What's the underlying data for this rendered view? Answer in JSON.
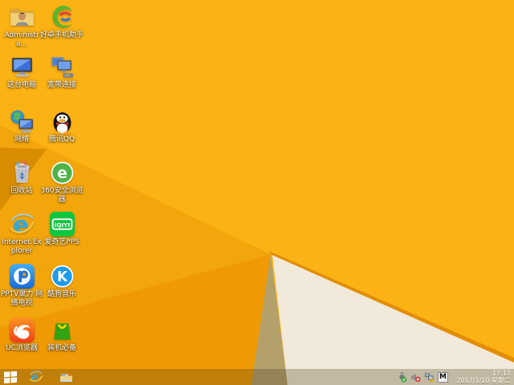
{
  "desktop": {
    "icons": [
      {
        "id": "admin-folder",
        "label": "Administra...",
        "position": {
          "col": 1,
          "row": 1
        }
      },
      {
        "id": "haozhuo-assistant",
        "label": "好卓手机助手",
        "position": {
          "col": 2,
          "row": 1
        }
      },
      {
        "id": "this-pc",
        "label": "这台电脑",
        "position": {
          "col": 1,
          "row": 2
        }
      },
      {
        "id": "broadband",
        "label": "宽带连接",
        "position": {
          "col": 2,
          "row": 2
        }
      },
      {
        "id": "network",
        "label": "网络",
        "position": {
          "col": 1,
          "row": 3
        }
      },
      {
        "id": "tencent-qq",
        "label": "腾讯QQ",
        "position": {
          "col": 2,
          "row": 3
        }
      },
      {
        "id": "recycle-bin",
        "label": "回收站",
        "position": {
          "col": 1,
          "row": 4
        }
      },
      {
        "id": "360-browser",
        "label": "360安全浏览器",
        "position": {
          "col": 2,
          "row": 4
        }
      },
      {
        "id": "internet-explorer",
        "label": "Internet Explorer",
        "position": {
          "col": 1,
          "row": 5
        }
      },
      {
        "id": "iqiyi-pps",
        "label": "爱奇艺PPS",
        "position": {
          "col": 2,
          "row": 5
        }
      },
      {
        "id": "pptv",
        "label": "PPTV聚力 网络电视",
        "position": {
          "col": 1,
          "row": 6
        }
      },
      {
        "id": "kugou-music",
        "label": "酷狗音乐",
        "position": {
          "col": 2,
          "row": 6
        }
      },
      {
        "id": "uc-browser",
        "label": "UC浏览器",
        "position": {
          "col": 1,
          "row": 7
        }
      },
      {
        "id": "zhuangji-bibei",
        "label": "装机必备",
        "position": {
          "col": 2,
          "row": 7
        }
      }
    ]
  },
  "wallpaper": {
    "base": "#FBB214",
    "left_shade": "#F3A60B",
    "dark_fold": "#D88C00",
    "deep_fold": "#EF9A04",
    "crease": "#E28E04",
    "shadow": "#B3A06B",
    "paper": "#F1E9DA"
  },
  "taskbar": {
    "start": {
      "id": "start-button"
    },
    "pinned": [
      {
        "id": "internet-explorer"
      },
      {
        "id": "file-explorer"
      }
    ],
    "tray": {
      "icons": [
        {
          "id": "safely-remove-hardware"
        },
        {
          "id": "volume-muted"
        },
        {
          "id": "network-status"
        }
      ],
      "ime_indicator": "M",
      "time": "17:17",
      "date": "2017/1/10 星期二"
    }
  }
}
